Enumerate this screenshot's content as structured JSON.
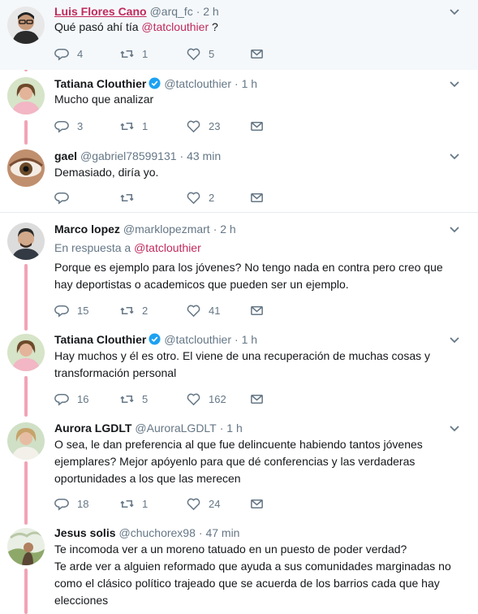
{
  "tweets": [
    {
      "name": "Luis Flores Cano",
      "handle": "@arq_fc",
      "time": "· 2 h",
      "text_pre": "Qué pasó ahí tía ",
      "text_mention": "@tatclouthier",
      "text_post": " ?",
      "replies": "4",
      "retweets": "1",
      "likes": "5"
    },
    {
      "name": "Tatiana Clouthier",
      "handle": "@tatclouthier",
      "time": "· 1 h",
      "text": "Mucho que analizar",
      "replies": "3",
      "retweets": "1",
      "likes": "23"
    },
    {
      "name": "gael",
      "handle": "@gabriel78599131",
      "time": "· 43 min",
      "text": "Demasiado, diría yo.",
      "replies": "",
      "retweets": "",
      "likes": "2"
    },
    {
      "name": "Marco lopez",
      "handle": "@marklopezmart",
      "time": "· 2 h",
      "reply_to_label": "En respuesta a",
      "reply_to_handle": "@tatclouthier",
      "text": "Porque es ejemplo para los jóvenes? No tengo nada en contra pero creo que hay deportistas o academicos que pueden ser un ejemplo.",
      "replies": "15",
      "retweets": "2",
      "likes": "41"
    },
    {
      "name": "Tatiana Clouthier",
      "handle": "@tatclouthier",
      "time": "· 1 h",
      "text": "Hay muchos y él es otro. El viene de una recuperación de muchas cosas y transformación personal",
      "replies": "16",
      "retweets": "5",
      "likes": "162"
    },
    {
      "name": "Aurora LGDLT",
      "handle": "@AuroraLGDLT",
      "time": "· 1 h",
      "text": "O sea, le dan preferencia al que fue delincuente habiendo tantos jóvenes ejemplares? Mejor apóyenlo para que dé conferencias y las verdaderas oportunidades a los que las merecen",
      "replies": "18",
      "retweets": "1",
      "likes": "24"
    },
    {
      "name": "Jesus solis",
      "handle": "@chuchorex98",
      "time": "· 47 min",
      "text_line1": "Te incomoda ver a un moreno tatuado en un puesto de poder verdad?",
      "text_line2": "Te arde ver a alguien reformado que ayuda a sus comunidades marginadas no como el clásico político trajeado que se acuerda de los barrios cada  que hay elecciones"
    }
  ],
  "colors": {
    "thread_line": "#f1a4b4",
    "mention": "#c02a5c",
    "muted": "#657786",
    "verified": "#1da1f2"
  }
}
